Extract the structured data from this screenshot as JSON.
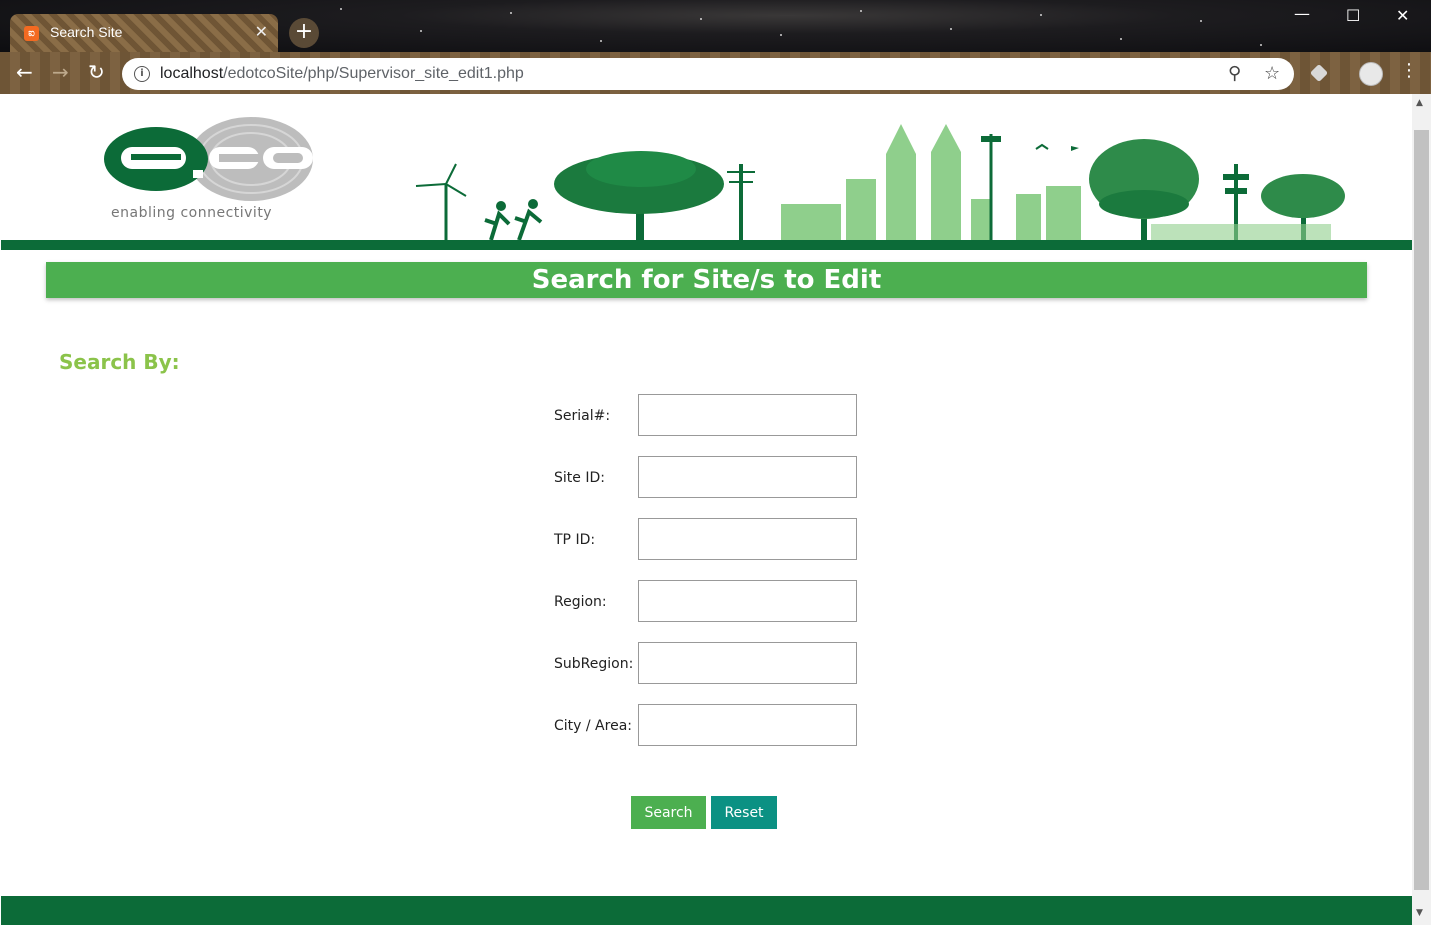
{
  "browser": {
    "tab_title": "Search Site",
    "tab_favicon": "xampp-icon",
    "url_host": "localhost",
    "url_path": "/edotcoSite/php/Supervisor_site_edit1.php"
  },
  "header": {
    "logo_text": "e.co",
    "tagline": "enabling connectivity"
  },
  "page": {
    "title": "Search for Site/s to Edit",
    "search_by": "Search By:"
  },
  "form": {
    "fields": [
      {
        "label": "Serial#:",
        "value": ""
      },
      {
        "label": "Site ID:",
        "value": ""
      },
      {
        "label": "TP ID:",
        "value": ""
      },
      {
        "label": "Region:",
        "value": ""
      },
      {
        "label": "SubRegion:",
        "value": ""
      },
      {
        "label": "City / Area:",
        "value": ""
      }
    ],
    "search_button": "Search",
    "reset_button": "Reset"
  },
  "colors": {
    "brand_dark_green": "#0c6b38",
    "title_green": "#4caf50",
    "search_by_green": "#8bc34a",
    "reset_teal": "#0b9183"
  }
}
